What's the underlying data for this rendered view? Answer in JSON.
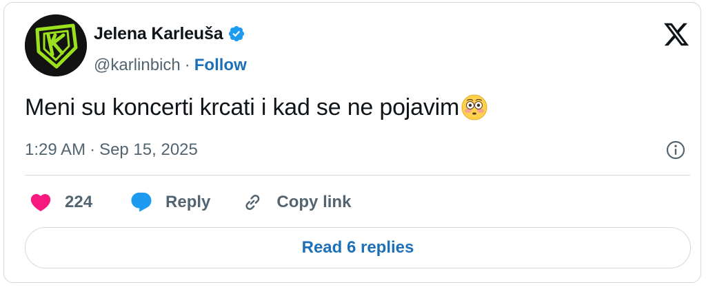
{
  "author": {
    "name": "Jelena Karleuša",
    "handle": "@karlinbich",
    "separator": "·",
    "follow_label": "Follow",
    "verified": true
  },
  "tweet": {
    "text": "Meni su koncerti krcati i kad se ne pojavim",
    "emoji": "flushed-face",
    "time": "1:29 AM",
    "separator": "·",
    "date": "Sep 15, 2025"
  },
  "actions": {
    "like_count": "224",
    "reply_label": "Reply",
    "copy_label": "Copy link"
  },
  "read_replies_label": "Read 6 replies",
  "colors": {
    "accent": "#1d6fb8",
    "like": "#f91880",
    "reply_icon": "#1d9bf0",
    "verified": "#1d9bf0",
    "muted_text": "#536471",
    "border": "#cfd9de",
    "avatar_logo": "#9be01c"
  }
}
